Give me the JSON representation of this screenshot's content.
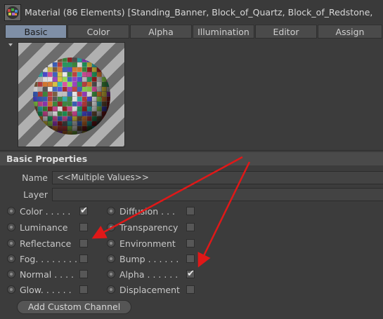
{
  "window": {
    "title": "Material (86 Elements) [Standing_Banner, Block_of_Quartz, Block_of_Redstone,"
  },
  "tabs": [
    {
      "label": "Basic",
      "active": true
    },
    {
      "label": "Color",
      "active": false
    },
    {
      "label": "Alpha",
      "active": false
    },
    {
      "label": "Illumination",
      "active": false
    },
    {
      "label": "Editor",
      "active": false
    },
    {
      "label": "Assign",
      "active": false
    }
  ],
  "section": {
    "title": "Basic Properties"
  },
  "fields": {
    "name": {
      "label": "Name",
      "value": "<<Multiple Values>>"
    },
    "layer": {
      "label": "Layer",
      "value": ""
    }
  },
  "channels_left": [
    {
      "label": "Color . . . . .",
      "checked": true
    },
    {
      "label": "Luminance",
      "checked": false
    },
    {
      "label": "Reflectance",
      "checked": false
    },
    {
      "label": "Fog. . . . . . . .",
      "checked": false
    },
    {
      "label": "Normal . . . .",
      "checked": false
    },
    {
      "label": "Glow. . . . . .",
      "checked": false
    }
  ],
  "channels_right": [
    {
      "label": "Diffusion . . .",
      "checked": false
    },
    {
      "label": "Transparency",
      "checked": false
    },
    {
      "label": "Environment",
      "checked": false
    },
    {
      "label": "Bump . . . . . .",
      "checked": false
    },
    {
      "label": "Alpha . . . . . .",
      "checked": true
    },
    {
      "label": "Displacement",
      "checked": false
    }
  ],
  "checkmark_glyph": "✔",
  "add_channel_button": {
    "label": "Add Custom Channel"
  },
  "annotation_color": "#e01818"
}
